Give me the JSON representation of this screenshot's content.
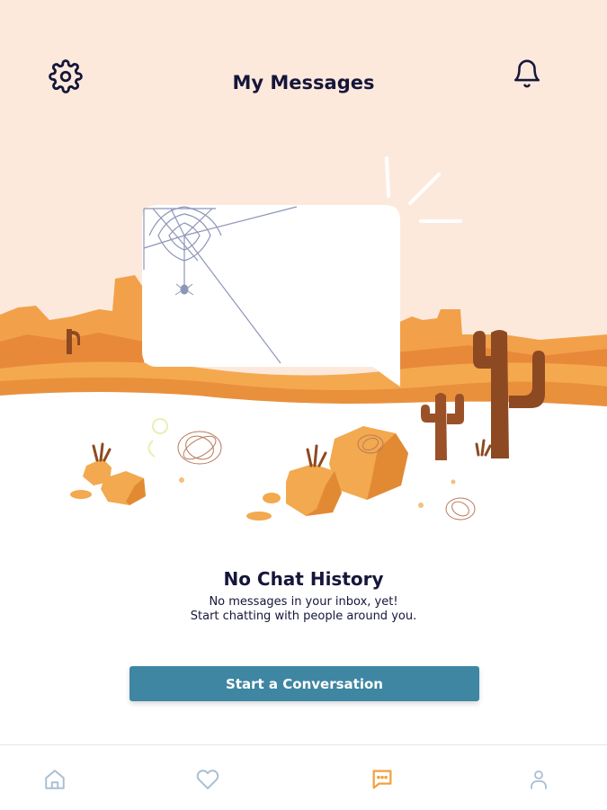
{
  "header": {
    "title": "My Messages",
    "settings_icon": "gear-icon",
    "notifications_icon": "bell-icon"
  },
  "empty_state": {
    "heading": "No Chat History",
    "line1": "No messages in your inbox, yet!",
    "line2": "Start chatting with people around you.",
    "cta_label": "Start a Conversation"
  },
  "bottom_nav": {
    "items": [
      {
        "icon": "home-icon",
        "active": false
      },
      {
        "icon": "heart-icon",
        "active": false
      },
      {
        "icon": "chat-icon",
        "active": true
      },
      {
        "icon": "profile-icon",
        "active": false
      }
    ]
  },
  "colors": {
    "sky": "#fde9dc",
    "accent_orange": "#f0a23c",
    "button": "#3f86a3",
    "text_dark": "#15163a",
    "nav_inactive": "#a9bfd3",
    "nav_active": "#f0a23c"
  }
}
